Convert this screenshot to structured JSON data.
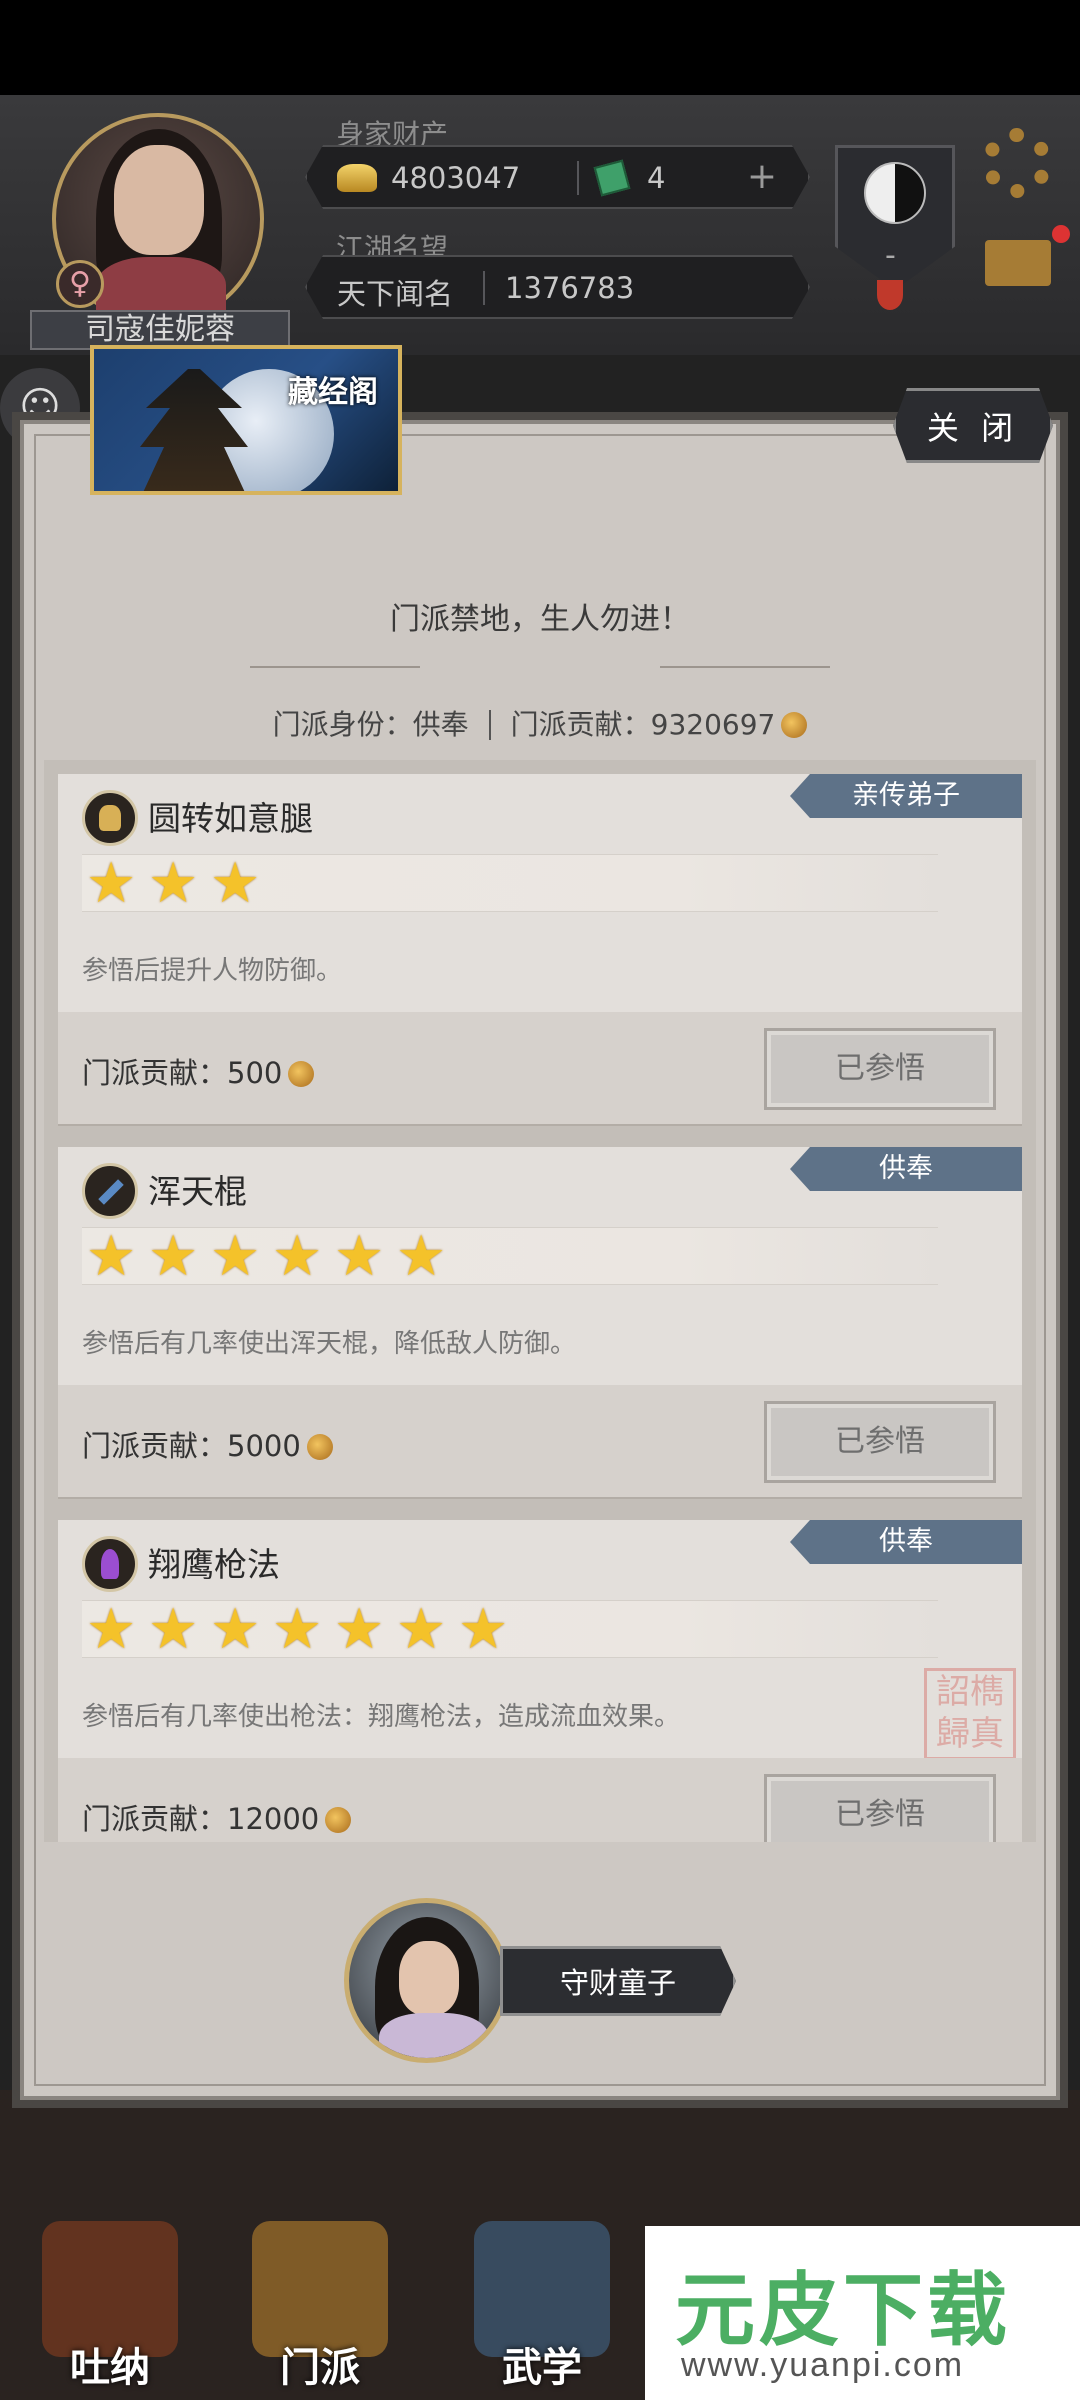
{
  "hud": {
    "name": "司寇佳妮蓉",
    "gender_symbol": "♀",
    "wealth_label": "身家财产",
    "gold": "4803047",
    "jade": "4",
    "plus": "+",
    "reputation_label": "江湖名望",
    "reputation_title": "天下闻名",
    "reputation_value": "1376783",
    "taiji_dash": "-"
  },
  "modal": {
    "header_title": "藏经阁",
    "close_label": "关 闭",
    "subtitle": "门派禁地，生人勿进！",
    "identity_label": "门派身份：供奉",
    "contribution_label": "门派贡献：9320697",
    "npc_name": "守财童子"
  },
  "skills": [
    {
      "rank": "亲传弟子",
      "name": "圆转如意腿",
      "stars": 3,
      "star_glyph": "★",
      "description": "参悟后提升人物防御。",
      "cost": "门派贡献：500",
      "button": "已参悟",
      "icon": "golden-statue-icon"
    },
    {
      "rank": "供奉",
      "name": "浑天棍",
      "stars": 6,
      "star_glyph": "★",
      "description": "参悟后有几率使出浑天棍，降低敌人防御。",
      "cost": "门派贡献：5000",
      "button": "已参悟",
      "icon": "staff-icon"
    },
    {
      "rank": "供奉",
      "name": "翔鹰枪法",
      "stars": 7,
      "star_glyph": "★",
      "description": "参悟后有几率使出枪法：翔鹰枪法，造成流血效果。",
      "cost": "门派贡献：12000",
      "button": "已参悟",
      "icon": "spear-icon",
      "seal": "詔檇歸真"
    }
  ],
  "nav": {
    "tab1": "吐纳",
    "tab2": "门派",
    "tab3": "武学"
  },
  "watermark": {
    "title": "元皮下载",
    "url": "www.yuanpi.com"
  },
  "colors": {
    "rank_tag": "#5e7288",
    "star": "#f4c22a",
    "frame_gold": "#d6b35d"
  }
}
